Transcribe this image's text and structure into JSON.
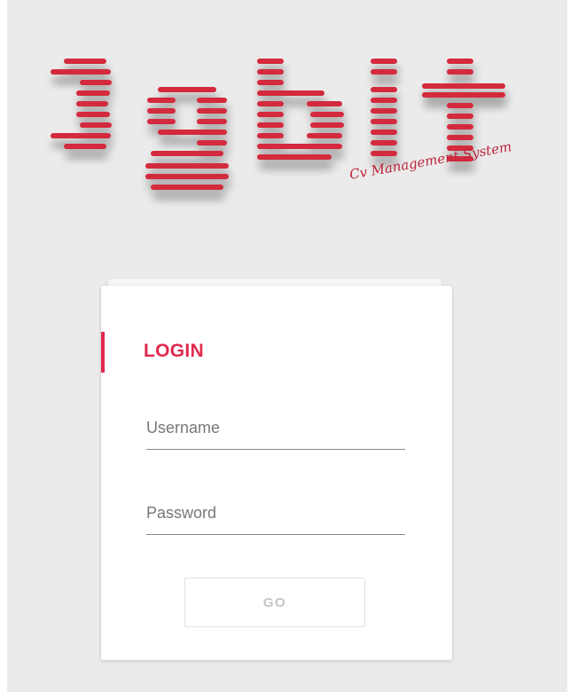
{
  "brand": {
    "logo": "3gbit",
    "tagline": "Cv Management System",
    "accent_color": "#d42a3c"
  },
  "login": {
    "title": "LOGIN",
    "accent_color": "#e0284d",
    "username_placeholder": "Username",
    "password_placeholder": "Password",
    "submit_label": "GO"
  }
}
